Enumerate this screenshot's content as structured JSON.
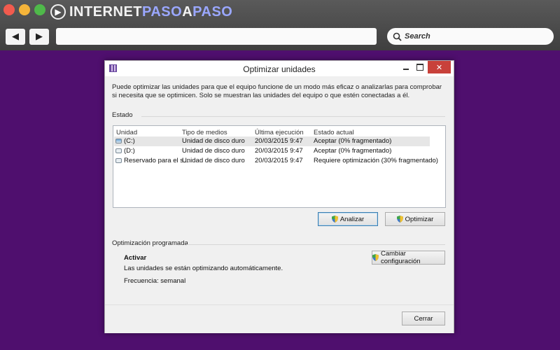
{
  "browser": {
    "logo": {
      "part_a": "INTERNET",
      "part_b": "PASO",
      "part_c": "A",
      "part_d": "PASO"
    },
    "search": {
      "placeholder": "Search"
    }
  },
  "window": {
    "title": "Optimizar unidades",
    "description": "Puede optimizar las unidades para que el equipo funcione de un modo más eficaz o analizarlas para comprobar si necesita que se optimicen. Solo se muestran las unidades del equipo o que estén conectadas a él.",
    "status_section": "Estado",
    "columns": [
      "Unidad",
      "Tipo de medios",
      "Última ejecución",
      "Estado actual"
    ],
    "drives": [
      {
        "unit": "(C:)",
        "type": "Unidad de disco duro",
        "last_run": "20/03/2015 9:47",
        "status": "Aceptar (0% fragmentado)"
      },
      {
        "unit": "(D:)",
        "type": "Unidad de disco duro",
        "last_run": "20/03/2015 9:47",
        "status": "Aceptar (0% fragmentado)"
      },
      {
        "unit": "Reservado para el s...",
        "type": "Unidad de disco duro",
        "last_run": "20/03/2015 9:47",
        "status": "Requiere optimización (30% fragmentado)"
      }
    ],
    "analyze_button": "Analizar",
    "optimize_button": "Optimizar",
    "scheduled_section": "Optimización programada",
    "scheduled_state": "Activar",
    "scheduled_desc": "Las unidades se están optimizando automáticamente.",
    "frequency": "Frecuencia: semanal",
    "change_config_button": "Cambiar configuración",
    "close_button": "Cerrar"
  },
  "colors": {
    "background": "#4f0f6e",
    "close_red": "#c8413a",
    "accent_blue": "#3c7fb1"
  }
}
